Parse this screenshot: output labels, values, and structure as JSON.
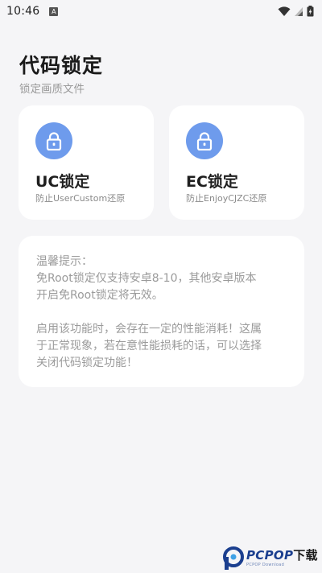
{
  "status_bar": {
    "time": "10:46",
    "notification_icon": "A"
  },
  "header": {
    "title": "代码锁定",
    "subtitle": "锁定画质文件"
  },
  "cards": [
    {
      "title": "UC锁定",
      "subtitle": "防止UserCustom还原",
      "icon": "lock-icon"
    },
    {
      "title": "EC锁定",
      "subtitle": "防止EnjoyCJZC还原",
      "icon": "lock-icon"
    }
  ],
  "notice": {
    "heading": "温馨提示：",
    "paragraph1": "免Root锁定仅支持安卓8-10，其他安卓版本\n开启免Root锁定将无效。",
    "paragraph2": "启用该功能时，会存在一定的性能消耗！这属\n于正常现象，若在意性能损耗的话，可以选择\n关闭代码锁定功能！"
  },
  "watermark": {
    "brand": "PCPOP",
    "suffix": "下载",
    "tagline": "PCPOP Download"
  },
  "colors": {
    "accent": "#6e9bec",
    "background": "#f5f5f7",
    "card": "#ffffff",
    "muted_text": "#9b9b9b"
  }
}
